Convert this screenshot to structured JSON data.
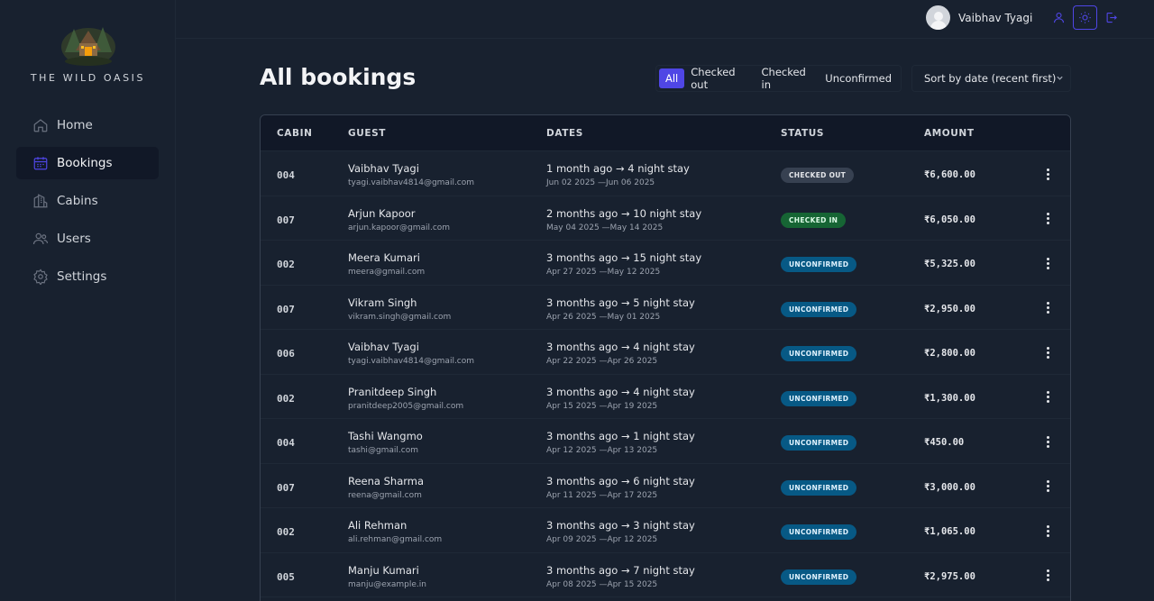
{
  "brand": {
    "name": "THE WILD OASIS"
  },
  "sidebar": {
    "items": [
      {
        "label": "Home",
        "icon": "home-icon"
      },
      {
        "label": "Bookings",
        "icon": "calendar-icon",
        "active": true
      },
      {
        "label": "Cabins",
        "icon": "buildings-icon"
      },
      {
        "label": "Users",
        "icon": "users-icon"
      },
      {
        "label": "Settings",
        "icon": "gear-icon"
      }
    ]
  },
  "header": {
    "user_name": "Vaibhav Tyagi",
    "accent_color": "#4f46e5"
  },
  "page": {
    "title": "All bookings",
    "filters": [
      "All",
      "Checked out",
      "Checked in",
      "Unconfirmed"
    ],
    "active_filter": "All",
    "sort_label": "Sort by date (recent first)"
  },
  "table": {
    "headers": [
      "CABIN",
      "GUEST",
      "DATES",
      "STATUS",
      "AMOUNT"
    ],
    "rows": [
      {
        "cabin": "004",
        "guest": "Vaibhav Tyagi",
        "email": "tyagi.vaibhav4814@gmail.com",
        "when": "1 month ago → 4 night stay",
        "range": "Jun 02 2025 —Jun 06 2025",
        "status": "CHECKED OUT",
        "status_class": "st-checked-out",
        "amount": "₹6,600.00"
      },
      {
        "cabin": "007",
        "guest": "Arjun Kapoor",
        "email": "arjun.kapoor@gmail.com",
        "when": "2 months ago → 10 night stay",
        "range": "May 04 2025 —May 14 2025",
        "status": "CHECKED IN",
        "status_class": "st-checked-in",
        "amount": "₹6,050.00"
      },
      {
        "cabin": "002",
        "guest": "Meera Kumari",
        "email": "meera@gmail.com",
        "when": "3 months ago → 15 night stay",
        "range": "Apr 27 2025 —May 12 2025",
        "status": "UNCONFIRMED",
        "status_class": "st-unconfirmed",
        "amount": "₹5,325.00"
      },
      {
        "cabin": "007",
        "guest": "Vikram Singh",
        "email": "vikram.singh@gmail.com",
        "when": "3 months ago → 5 night stay",
        "range": "Apr 26 2025 —May 01 2025",
        "status": "UNCONFIRMED",
        "status_class": "st-unconfirmed",
        "amount": "₹2,950.00"
      },
      {
        "cabin": "006",
        "guest": "Vaibhav Tyagi",
        "email": "tyagi.vaibhav4814@gmail.com",
        "when": "3 months ago → 4 night stay",
        "range": "Apr 22 2025 —Apr 26 2025",
        "status": "UNCONFIRMED",
        "status_class": "st-unconfirmed",
        "amount": "₹2,800.00"
      },
      {
        "cabin": "002",
        "guest": "Pranitdeep Singh",
        "email": "pranitdeep2005@gmail.com",
        "when": "3 months ago → 4 night stay",
        "range": "Apr 15 2025 —Apr 19 2025",
        "status": "UNCONFIRMED",
        "status_class": "st-unconfirmed",
        "amount": "₹1,300.00"
      },
      {
        "cabin": "004",
        "guest": "Tashi Wangmo",
        "email": "tashi@gmail.com",
        "when": "3 months ago → 1 night stay",
        "range": "Apr 12 2025 —Apr 13 2025",
        "status": "UNCONFIRMED",
        "status_class": "st-unconfirmed",
        "amount": "₹450.00"
      },
      {
        "cabin": "007",
        "guest": "Reena Sharma",
        "email": "reena@gmail.com",
        "when": "3 months ago → 6 night stay",
        "range": "Apr 11 2025 —Apr 17 2025",
        "status": "UNCONFIRMED",
        "status_class": "st-unconfirmed",
        "amount": "₹3,000.00"
      },
      {
        "cabin": "002",
        "guest": "Ali Rehman",
        "email": "ali.rehman@gmail.com",
        "when": "3 months ago → 3 night stay",
        "range": "Apr 09 2025 —Apr 12 2025",
        "status": "UNCONFIRMED",
        "status_class": "st-unconfirmed",
        "amount": "₹1,065.00"
      },
      {
        "cabin": "005",
        "guest": "Manju Kumari",
        "email": "manju@example.in",
        "when": "3 months ago → 7 night stay",
        "range": "Apr 08 2025 —Apr 15 2025",
        "status": "UNCONFIRMED",
        "status_class": "st-unconfirmed",
        "amount": "₹2,975.00"
      }
    ]
  }
}
